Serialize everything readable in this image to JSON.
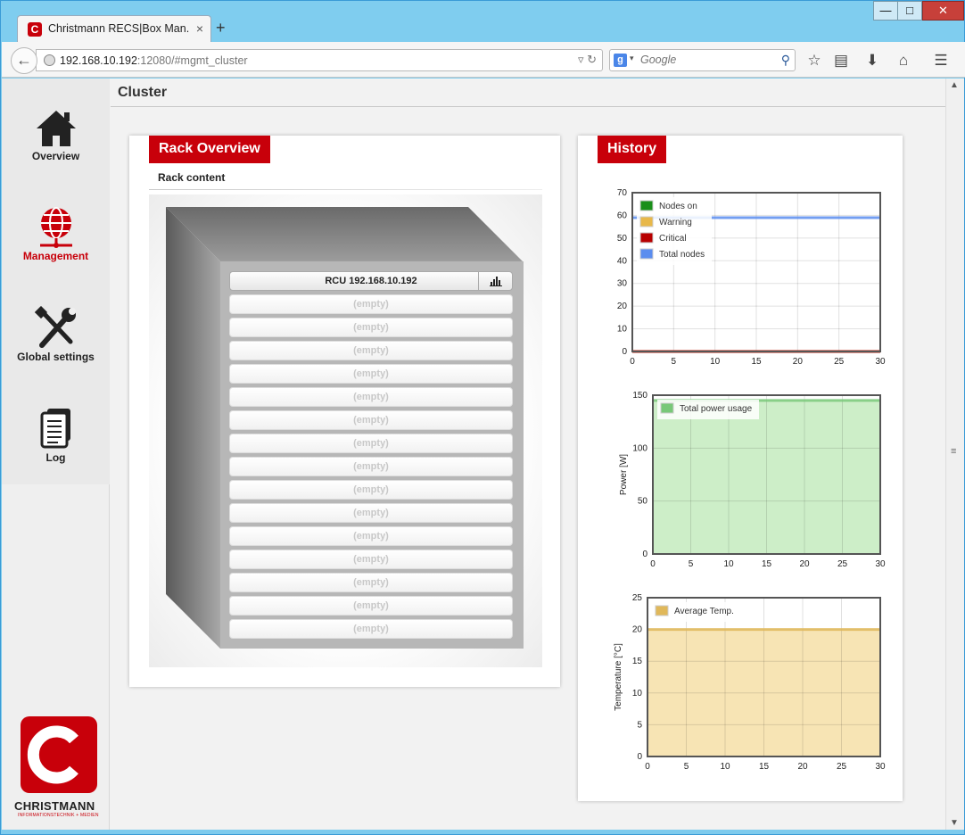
{
  "browser": {
    "tab_title": "Christmann RECS|Box Man...",
    "tab_close": "×",
    "new_tab": "+",
    "back": "←",
    "url_host": "192.168.10.192",
    "url_rest": ":12080/#mgmt_cluster",
    "search_placeholder": "Google",
    "window_min": "—",
    "window_max": "□",
    "window_close": "✕",
    "toolbar_icons": [
      "star-icon",
      "reader-icon",
      "download-icon",
      "home-icon",
      "menu-icon"
    ]
  },
  "sidebar": {
    "items": [
      {
        "label": "Overview",
        "icon": "home-icon"
      },
      {
        "label": "Management",
        "icon": "globe-network-icon",
        "active": true
      },
      {
        "label": "Global settings",
        "icon": "tools-icon"
      },
      {
        "label": "Log",
        "icon": "document-icon"
      }
    ],
    "logo_text": "CHRISTMANN",
    "logo_sub": "INFORMATIONSTECHNIK + MEDIEN",
    "logo_letter": "C"
  },
  "page": {
    "title": "Cluster"
  },
  "rack": {
    "heading": "Rack Overview",
    "subheading": "Rack content",
    "rcu_label": "RCU 192.168.10.192",
    "empty_label": "(empty)",
    "empty_slot_count": 15
  },
  "history": {
    "heading": "History"
  },
  "chart_data": [
    {
      "type": "line",
      "x": [
        0,
        30
      ],
      "xlim": [
        0,
        30
      ],
      "ylim": [
        0,
        70
      ],
      "xticks": [
        0,
        5,
        10,
        15,
        20,
        25,
        30
      ],
      "yticks": [
        0,
        10,
        20,
        30,
        40,
        50,
        60,
        70
      ],
      "series": [
        {
          "name": "Nodes on",
          "color": "#1a8f1a",
          "values": [
            0,
            0
          ]
        },
        {
          "name": "Warning",
          "color": "#e8b84a",
          "values": [
            0,
            0
          ]
        },
        {
          "name": "Critical",
          "color": "#b80000",
          "values": [
            0,
            0
          ]
        },
        {
          "name": "Total nodes",
          "color": "#5b8def",
          "values": [
            59,
            59
          ]
        }
      ],
      "legend": "top-left",
      "grid": true
    },
    {
      "type": "area",
      "x": [
        0,
        30
      ],
      "xlim": [
        0,
        30
      ],
      "ylim": [
        0,
        150
      ],
      "xticks": [
        0,
        5,
        10,
        15,
        20,
        25,
        30
      ],
      "yticks": [
        0,
        50,
        100,
        150
      ],
      "ylabel": "Power [W]",
      "series": [
        {
          "name": "Total power usage",
          "color": "#78c878",
          "fill": "#cdeec8",
          "values": [
            145,
            145
          ]
        }
      ],
      "legend": "top-left",
      "grid": true
    },
    {
      "type": "area",
      "x": [
        0,
        30
      ],
      "xlim": [
        0,
        30
      ],
      "ylim": [
        0,
        25
      ],
      "xticks": [
        0,
        5,
        10,
        15,
        20,
        25,
        30
      ],
      "yticks": [
        0,
        5,
        10,
        15,
        20,
        25
      ],
      "ylabel": "Temperature [°C]",
      "series": [
        {
          "name": "Average Temp.",
          "color": "#e0b85a",
          "fill": "#f7e4b4",
          "values": [
            20,
            20
          ]
        }
      ],
      "legend": "top-left",
      "grid": true
    }
  ]
}
